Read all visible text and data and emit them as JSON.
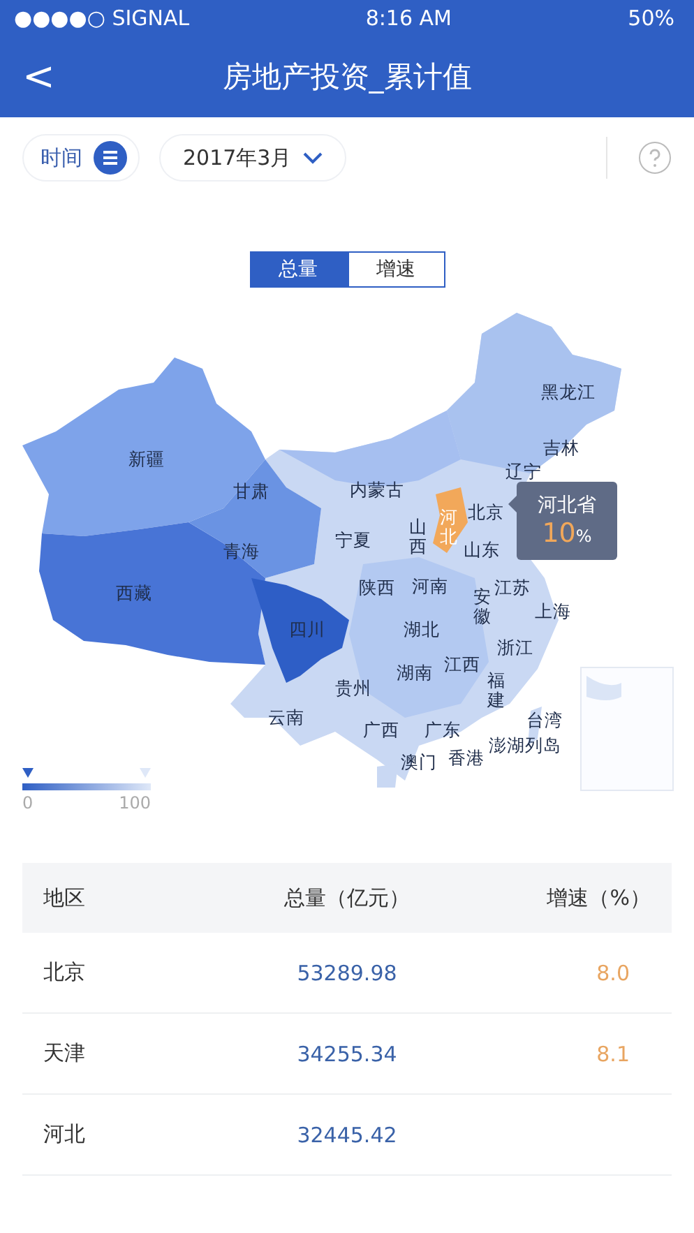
{
  "status_bar": {
    "signal": "●●●●○ SIGNAL",
    "time": "8:16 AM",
    "battery": "50%"
  },
  "nav": {
    "back": "<",
    "title": "房地产投资_累计值"
  },
  "filters": {
    "time_label": "时间",
    "date": "2017年3月"
  },
  "toggle": [
    {
      "label": "总量",
      "selected": true
    },
    {
      "label": "增速",
      "selected": false
    }
  ],
  "map": {
    "provinces": [
      {
        "name": "新疆",
        "selected": false
      },
      {
        "name": "甘肃",
        "selected": false
      },
      {
        "name": "内蒙古",
        "selected": false
      },
      {
        "name": "黑龙江",
        "selected": false
      },
      {
        "name": "吉林",
        "selected": false
      },
      {
        "name": "辽宁",
        "selected": false
      },
      {
        "name": "山西",
        "selected": false
      },
      {
        "name": "河北",
        "selected": true
      },
      {
        "name": "北京",
        "selected": false
      },
      {
        "name": "山东",
        "selected": false
      },
      {
        "name": "宁夏",
        "selected": false
      },
      {
        "name": "青海",
        "selected": false
      },
      {
        "name": "西藏",
        "selected": false
      },
      {
        "name": "四川",
        "selected": false
      },
      {
        "name": "陕西",
        "selected": false
      },
      {
        "name": "河南",
        "selected": false
      },
      {
        "name": "江苏",
        "selected": false
      },
      {
        "name": "安徽",
        "selected": false
      },
      {
        "name": "上海",
        "selected": false
      },
      {
        "name": "湖北",
        "selected": false
      },
      {
        "name": "浙江",
        "selected": false
      },
      {
        "name": "江西",
        "selected": false
      },
      {
        "name": "湖南",
        "selected": false
      },
      {
        "name": "贵州",
        "selected": false
      },
      {
        "name": "福建",
        "selected": false
      },
      {
        "name": "云南",
        "selected": false
      },
      {
        "name": "广西",
        "selected": false
      },
      {
        "name": "广东",
        "selected": false
      },
      {
        "name": "台湾",
        "selected": false
      },
      {
        "name": "澎湖列岛",
        "selected": false
      },
      {
        "name": "香港",
        "selected": false
      },
      {
        "name": "澳门",
        "selected": false
      }
    ],
    "tooltip": {
      "name": "河北省",
      "value": "10",
      "unit": "%"
    },
    "legend": {
      "min": "0",
      "max": "100"
    }
  },
  "table": {
    "columns": [
      "地区",
      "总量（亿元）",
      "增速（%）"
    ],
    "rows": [
      {
        "region": "北京",
        "total": "53289.98",
        "growth": "8.0"
      },
      {
        "region": "天津",
        "total": "34255.34",
        "growth": "8.1"
      },
      {
        "region": "河北",
        "total": "32445.42"
      }
    ]
  }
}
